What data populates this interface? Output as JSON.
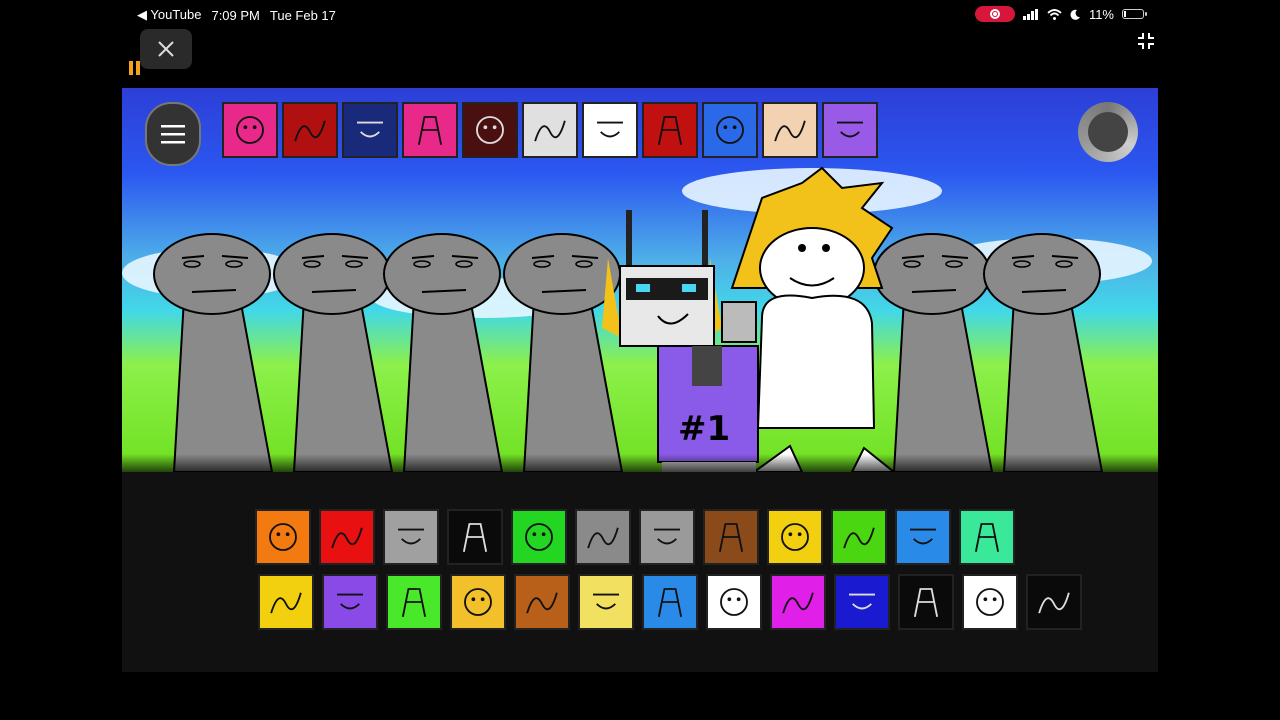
{
  "status_bar": {
    "back_label": "◀ YouTube",
    "time": "7:09 PM",
    "date": "Tue Feb 17",
    "battery": "11%",
    "battery_level": 0.11
  },
  "player": {
    "close_icon": "close-icon",
    "exit_fullscreen_icon": "exit-fullscreen-icon"
  },
  "game": {
    "menu_icon": "hamburger-menu-icon",
    "top_slots": [
      {
        "color": "#e8298a",
        "icon": "pink-sigil-icon"
      },
      {
        "color": "#b01010",
        "icon": "red-circle-icon"
      },
      {
        "color": "#1a2a7a",
        "icon": "blue-static-icon"
      },
      {
        "color": "#e8298a",
        "icon": "gray-face-icon"
      },
      {
        "color": "#4a1010",
        "icon": "dark-scribble-icon"
      },
      {
        "color": "#e0e0e0",
        "icon": "cd-disc-icon"
      },
      {
        "color": "#ffffff",
        "icon": "cat-face-icon"
      },
      {
        "color": "#c01010",
        "icon": "red-face-icon"
      },
      {
        "color": "#2a6ae8",
        "icon": "blue-smile-icon"
      },
      {
        "color": "#f2d2b0",
        "icon": "tan-scribble-icon"
      },
      {
        "color": "#9a5ae8",
        "icon": "bird-icon"
      }
    ],
    "bottom_row_1": [
      {
        "color": "#f27a10",
        "icon": "orange-face-icon"
      },
      {
        "color": "#e81010",
        "icon": "red-spiky-icon"
      },
      {
        "color": "#a0a0a0",
        "icon": "gray-hat-icon"
      },
      {
        "color": "#0a0a0a",
        "icon": "black-blank-icon"
      },
      {
        "color": "#22d622",
        "icon": "green-scribble-icon"
      },
      {
        "color": "#8a8a8a",
        "icon": "gray-head-icon"
      },
      {
        "color": "#9a9a9a",
        "icon": "gray-face-icon-2"
      },
      {
        "color": "#8a4a1a",
        "icon": "brown-hair-icon"
      },
      {
        "color": "#f2d010",
        "icon": "yellow-face-icon"
      },
      {
        "color": "#4ad610",
        "icon": "green-crown-icon"
      },
      {
        "color": "#2a8ae8",
        "icon": "blue-balloon-icon"
      },
      {
        "color": "#3ae89a",
        "icon": "teal-scribble-icon"
      }
    ],
    "bottom_row_2": [
      {
        "color": "#f2d010",
        "icon": "sun-face-icon"
      },
      {
        "color": "#8a4ae8",
        "icon": "purple-headband-icon"
      },
      {
        "color": "#4ae82a",
        "icon": "green-stick-icon"
      },
      {
        "color": "#f2c02a",
        "icon": "yellow-grin-icon"
      },
      {
        "color": "#b8601a",
        "icon": "brown-scribble-icon"
      },
      {
        "color": "#f2e060",
        "icon": "yellow-lines-icon"
      },
      {
        "color": "#2a8ae8",
        "icon": "blue-scribble-icon"
      },
      {
        "color": "#ffffff",
        "icon": "white-fox-icon"
      },
      {
        "color": "#e020e8",
        "icon": "magenta-eyes-icon"
      },
      {
        "color": "#1a1ad0",
        "icon": "black-oval-icon"
      },
      {
        "color": "#0a0a0a",
        "icon": "black-figure-icon"
      },
      {
        "color": "#ffffff",
        "icon": "white-crescent-icon"
      },
      {
        "color": "#0a0a0a",
        "icon": "orange-face-outline-icon"
      }
    ]
  }
}
